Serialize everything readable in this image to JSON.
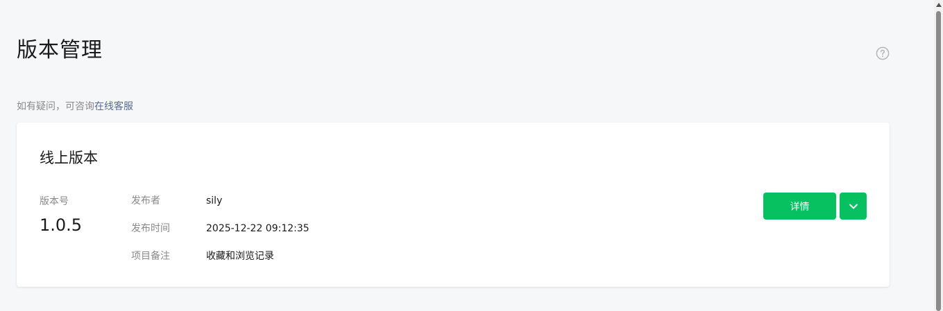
{
  "header": {
    "title": "版本管理",
    "help_icon": "question-circle-icon"
  },
  "hint": {
    "text": "如有疑问，可咨询",
    "link": "在线客服"
  },
  "online_version": {
    "title": "线上版本",
    "version_label": "版本号",
    "version_number": "1.0.5",
    "publisher_label": "发布者",
    "publisher_value": "sily",
    "publish_time_label": "发布时间",
    "publish_time_value": "2025-12-22 09:12:35",
    "remark_label": "项目备注",
    "remark_value": "收藏和浏览记录",
    "detail_button": "详情",
    "dropdown_icon": "chevron-down-icon"
  },
  "colors": {
    "accent": "#07c160",
    "link": "#576b95",
    "background": "#f6f7f9"
  }
}
